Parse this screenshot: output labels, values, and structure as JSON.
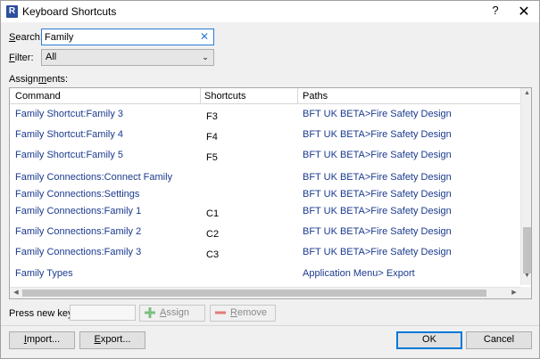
{
  "window": {
    "title": "Keyboard Shortcuts",
    "help_glyph": "?",
    "close_glyph": "✕",
    "app_icon_letter": "R"
  },
  "search": {
    "label_accel": "S",
    "label_rest": "earch:",
    "value": "Family",
    "placeholder": "",
    "clear_glyph": "✕"
  },
  "filter": {
    "label_accel": "F",
    "label_rest": "ilter:",
    "value": "All",
    "arrow_glyph": "⌄"
  },
  "assignments": {
    "label_pre": "Assign",
    "label_accel": "m",
    "label_rest": "ents:",
    "columns": [
      "Command",
      "Shortcuts",
      "Paths"
    ],
    "rows": [
      {
        "command": "Family Shortcut:Family 3",
        "shortcut": "F3",
        "path": "BFT UK BETA>Fire Safety Design"
      },
      {
        "command": "Family Shortcut:Family 4",
        "shortcut": "F4",
        "path": "BFT UK BETA>Fire Safety Design"
      },
      {
        "command": "Family Shortcut:Family 5",
        "shortcut": "F5",
        "path": "BFT UK BETA>Fire Safety Design"
      },
      {
        "command": "Family Connections:Connect Family",
        "shortcut": "",
        "path": "BFT UK BETA>Fire Safety Design"
      },
      {
        "command": "Family Connections:Settings",
        "shortcut": "",
        "path": "BFT UK BETA>Fire Safety Design"
      },
      {
        "command": "Family Connections:Family 1",
        "shortcut": "C1",
        "path": "BFT UK BETA>Fire Safety Design"
      },
      {
        "command": "Family Connections:Family 2",
        "shortcut": "C2",
        "path": "BFT UK BETA>Fire Safety Design"
      },
      {
        "command": "Family Connections:Family 3",
        "shortcut": "C3",
        "path": "BFT UK BETA>Fire Safety Design"
      },
      {
        "command": "Family Types",
        "shortcut": "",
        "path": "Application Menu> Export"
      }
    ],
    "scroll_glyphs": {
      "up": "▲",
      "down": "▼",
      "left": "◀",
      "right": "▶"
    }
  },
  "press_keys": {
    "label": "Press new keys:",
    "value": ""
  },
  "assign_button": {
    "label_accel": "A",
    "label_rest": "ssign"
  },
  "remove_button": {
    "label_accel": "R",
    "label_rest": "emove"
  },
  "footer": {
    "import_accel": "I",
    "import_rest": "mport...",
    "export_accel": "E",
    "export_rest": "xport...",
    "ok": "OK",
    "cancel": "Cancel"
  },
  "colors": {
    "accent": "#0078d7",
    "link": "#1a3a8e",
    "add_icon": "#4caf50",
    "remove_icon": "#e05a5a"
  }
}
